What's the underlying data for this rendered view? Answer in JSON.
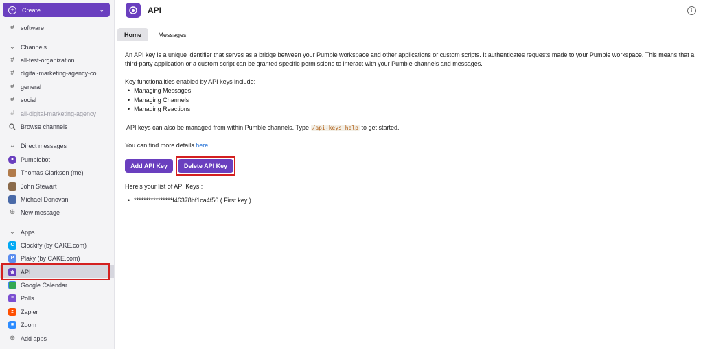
{
  "sidebar": {
    "create_label": "Create",
    "items": [
      {
        "label": "software",
        "icon": "hash-icon"
      },
      {
        "label": "Channels",
        "icon": "chevron-down-icon"
      },
      {
        "label": "all-test-organization",
        "icon": "hash-icon"
      },
      {
        "label": "digital-marketing-agency-co...",
        "icon": "hash-icon"
      },
      {
        "label": "general",
        "icon": "hash-icon"
      },
      {
        "label": "social",
        "icon": "hash-icon"
      },
      {
        "label": "all-digital-marketing-agency",
        "icon": "hash-icon"
      },
      {
        "label": "Browse channels",
        "icon": "search-icon"
      },
      {
        "label": "Direct messages",
        "icon": "chevron-down-icon"
      },
      {
        "label": "Pumblebot",
        "icon": "bot-avatar"
      },
      {
        "label": "Thomas Clarkson (me)",
        "icon": "user-avatar"
      },
      {
        "label": "John Stewart",
        "icon": "user-avatar"
      },
      {
        "label": "Michael Donovan",
        "icon": "user-avatar"
      },
      {
        "label": "New message",
        "icon": "plus-circle-icon"
      },
      {
        "label": "Apps",
        "icon": "chevron-down-icon"
      },
      {
        "label": "Clockify (by CAKE.com)",
        "icon": "clockify-icon"
      },
      {
        "label": "Plaky (by CAKE.com)",
        "icon": "plaky-icon"
      },
      {
        "label": "API",
        "icon": "api-icon"
      },
      {
        "label": "Google Calendar",
        "icon": "calendar-icon"
      },
      {
        "label": "Polls",
        "icon": "polls-icon"
      },
      {
        "label": "Zapier",
        "icon": "zapier-icon"
      },
      {
        "label": "Zoom",
        "icon": "zoom-icon"
      },
      {
        "label": "Add apps",
        "icon": "plus-circle-icon"
      }
    ]
  },
  "header": {
    "title": "API"
  },
  "tabs": [
    {
      "label": "Home"
    },
    {
      "label": "Messages"
    }
  ],
  "content": {
    "intro": "An API key is a unique identifier that serves as a bridge between your Pumble workspace and other applications or custom scripts. It authenticates requests made to your Pumble workspace. This means that a third-party application or a custom script can be granted specific permissions to interact with your Pumble channels and messages.",
    "features_heading": "Key functionalities enabled by API keys include:",
    "features": [
      "Managing Messages",
      "Managing Channels",
      "Managing Reactions"
    ],
    "channels_text_before": "API keys can also be managed from within Pumble channels. Type",
    "channels_command": "/api-keys help",
    "channels_text_after": "to get started.",
    "details_before": "You can find more details",
    "details_link": "here",
    "details_after": ".",
    "add_button": "Add API Key",
    "delete_button": "Delete API Key",
    "list_heading": "Here's your list of API Keys :",
    "keys": [
      "****************f46378bf1ca4f56 ( First key )"
    ]
  },
  "colors": {
    "accent": "#6a3fbf",
    "highlight": "#d42020",
    "link": "#1f6fd6"
  }
}
